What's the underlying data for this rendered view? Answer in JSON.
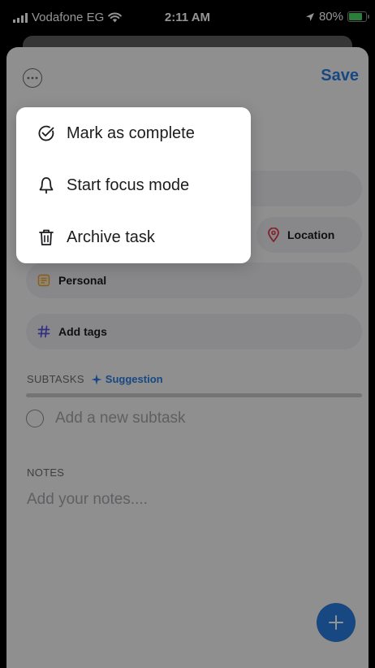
{
  "status_bar": {
    "carrier": "Vodafone EG",
    "time": "2:11 AM",
    "battery": "80%",
    "colors": {
      "battery_fill": "#4cd964"
    }
  },
  "header": {
    "save_label": "Save",
    "more_icon": "ellipsis-circle-icon"
  },
  "fields": {
    "location_label": "Location",
    "list_label": "Personal",
    "tags_label": "Add tags"
  },
  "subtasks": {
    "section_label": "SUBTASKS",
    "suggestion_label": "Suggestion",
    "new_placeholder": "Add a new subtask"
  },
  "notes": {
    "section_label": "NOTES",
    "placeholder": "Add your notes...."
  },
  "context_menu": {
    "items": [
      {
        "label": "Mark as complete",
        "icon": "check-circle-icon"
      },
      {
        "label": "Start focus mode",
        "icon": "bell-icon"
      },
      {
        "label": "Archive task",
        "icon": "trash-icon"
      }
    ]
  },
  "colors": {
    "accent": "#2a7de1",
    "location_icon": "#e0394b",
    "list_icon": "#e6a23c",
    "tags_icon": "#5b4fe3"
  }
}
